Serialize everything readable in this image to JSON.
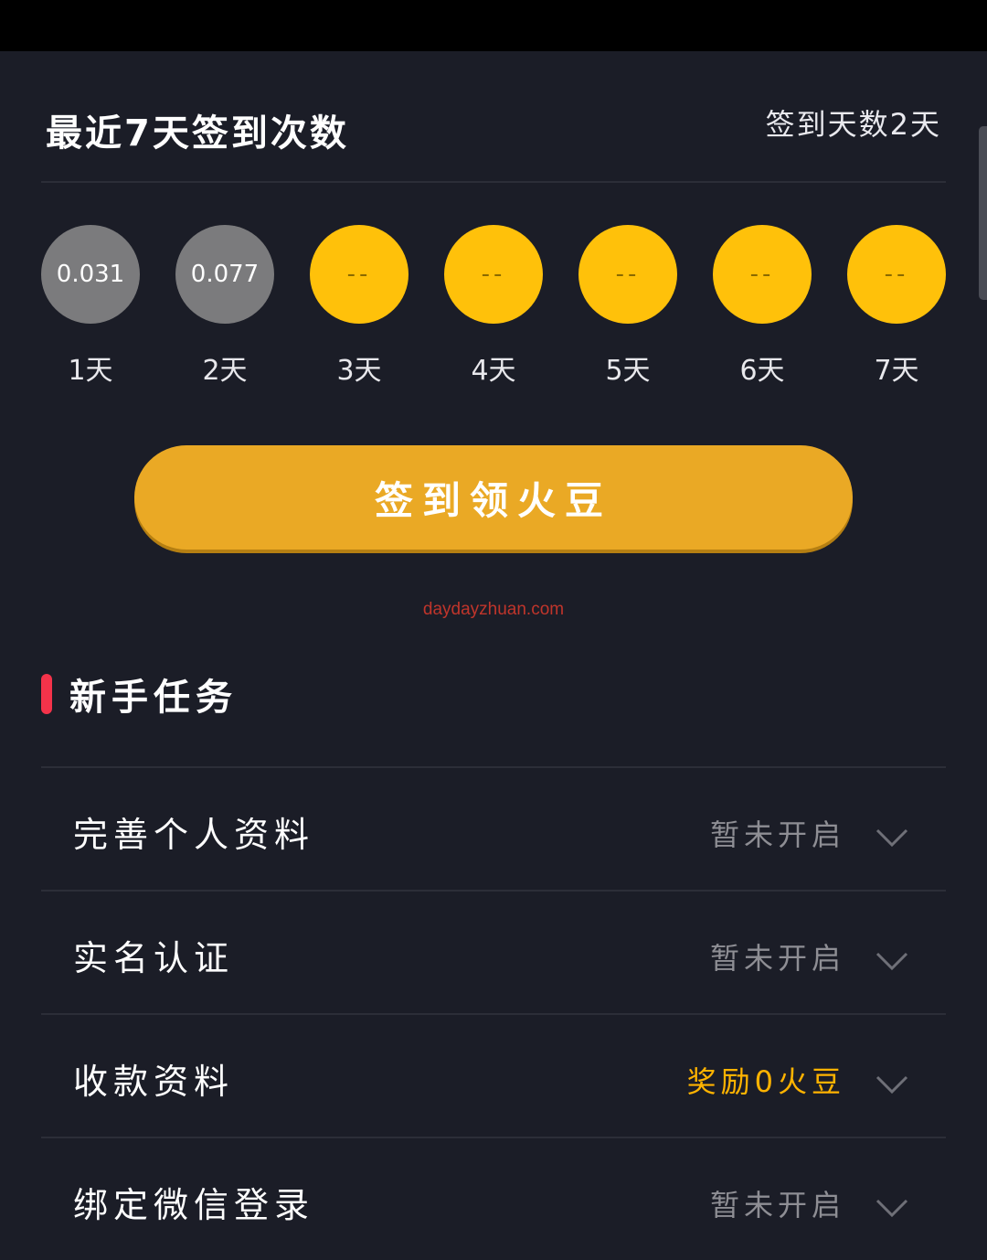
{
  "signin": {
    "title": "最近7天签到次数",
    "count_text": "签到天数2天",
    "days": [
      {
        "value": "0.031",
        "label": "1天",
        "done": true
      },
      {
        "value": "0.077",
        "label": "2天",
        "done": true
      },
      {
        "value": "--",
        "label": "3天",
        "done": false
      },
      {
        "value": "--",
        "label": "4天",
        "done": false
      },
      {
        "value": "--",
        "label": "5天",
        "done": false
      },
      {
        "value": "--",
        "label": "6天",
        "done": false
      },
      {
        "value": "--",
        "label": "7天",
        "done": false
      }
    ],
    "button_label": "签到领火豆"
  },
  "watermark": "daydayzhuan.com",
  "tasks": {
    "title": "新手任务",
    "items": [
      {
        "name": "完善个人资料",
        "status": "暂未开启"
      },
      {
        "name": "实名认证",
        "status": "暂未开启"
      },
      {
        "name": "收款资料",
        "status": "奖励0火豆"
      },
      {
        "name": "绑定微信登录",
        "status": "暂未开启"
      }
    ]
  },
  "colors": {
    "background": "#1b1d27",
    "coin_done": "#7b7b7d",
    "coin_pending": "#ffc10a",
    "button": "#eaa925",
    "accent_bar": "#f4334a",
    "reward_text": "#ffb300"
  },
  "icons": {
    "task_expand": "chevron-down-icon"
  }
}
